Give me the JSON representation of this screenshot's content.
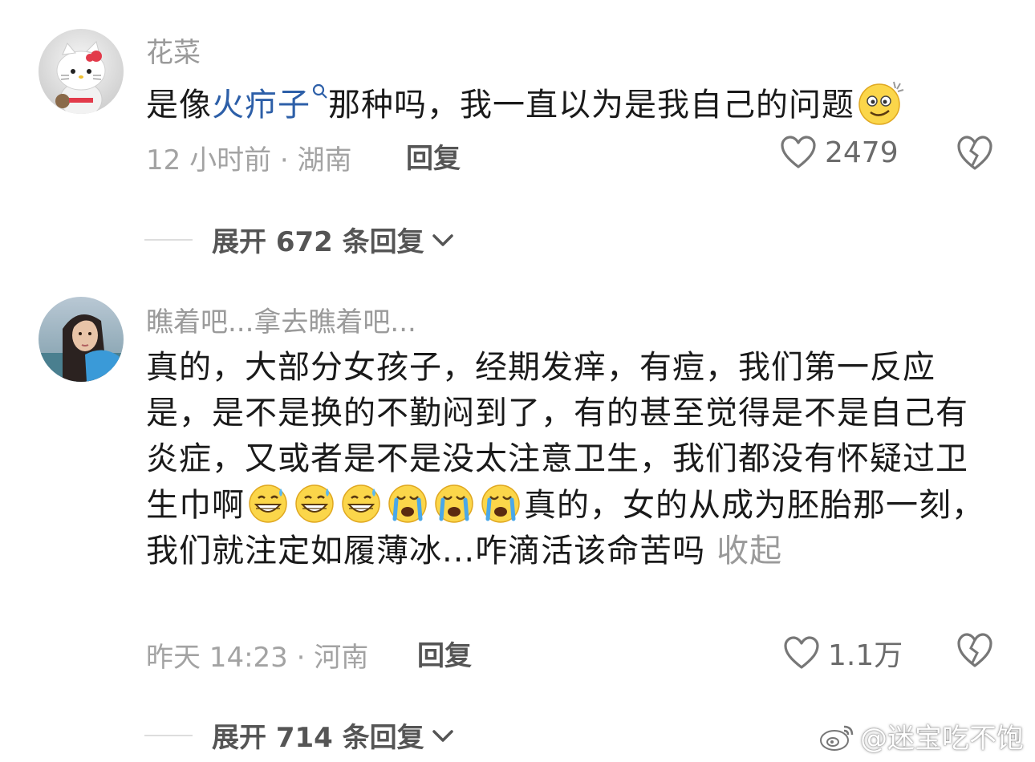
{
  "comments": [
    {
      "username": "花菜",
      "text_before": "是像",
      "search_term": "火疖子",
      "text_after": "那种吗，我一直以为是我自己的问题",
      "time_location": "12 小时前 · 湖南",
      "reply_label": "回复",
      "likes": "2479",
      "expand_label": "展开 672 条回复",
      "avatar_icon": "hello-kitty-avatar"
    },
    {
      "username": "瞧着吧...拿去瞧着吧...",
      "text_main": "真的，大部分女孩子，经期发痒，有痘，我们第一反应是，是不是换的不勤闷到了，有的甚至觉得是不是自己有炎症，又或者是不是没太注意卫生，我们都没有怀疑过卫生巾啊",
      "text_tail": "真的，女的从成为胚胎那一刻，我们就注定如履薄冰...咋滴活该命苦吗",
      "collapse_label": "收起",
      "time_location": "昨天 14:23 · 河南",
      "reply_label": "回复",
      "likes": "1.1万",
      "expand_label": "展开 714 条回复",
      "avatar_icon": "girl-photo-avatar"
    }
  ],
  "watermark": {
    "text": "@迷宝吃不饱",
    "icon": "weibo-logo-icon"
  },
  "colors": {
    "link": "#2d5fa8",
    "meta": "#a3a3a3",
    "username": "#9a9a9a"
  }
}
